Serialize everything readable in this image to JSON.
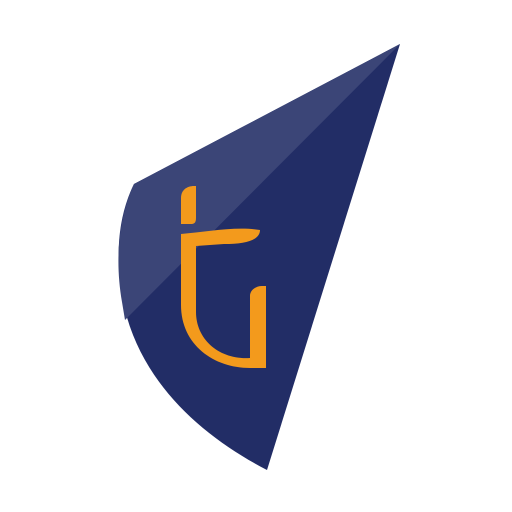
{
  "logo": {
    "colors": {
      "background": "#ffffff",
      "sail_dark": "#222d66",
      "sail_highlight": "#3b4577",
      "mark_orange": "#f39a1c"
    },
    "icon": "sail-monogram-logo"
  }
}
